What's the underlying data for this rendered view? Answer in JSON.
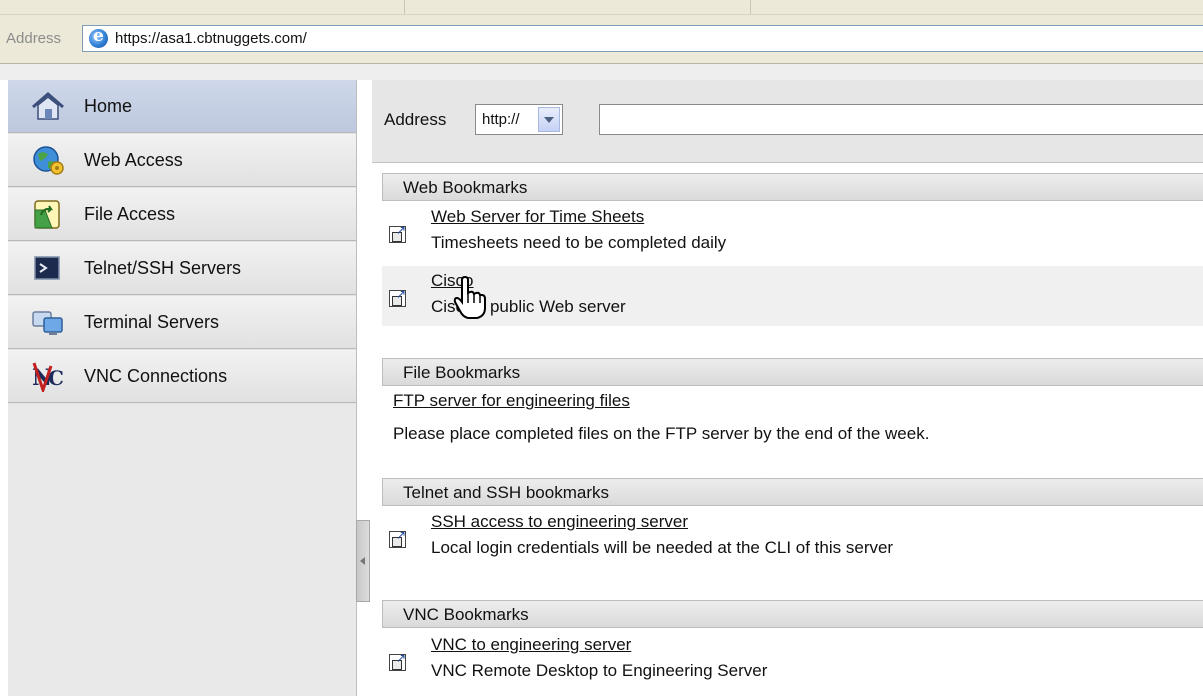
{
  "browser": {
    "address_label": "Address",
    "url": "https://asa1.cbtnuggets.com/"
  },
  "sidebar": {
    "items": [
      {
        "label": "Home",
        "icon": "home-icon"
      },
      {
        "label": "Web Access",
        "icon": "web-access-icon"
      },
      {
        "label": "File Access",
        "icon": "file-access-icon"
      },
      {
        "label": "Telnet/SSH Servers",
        "icon": "terminal-icon"
      },
      {
        "label": "Terminal Servers",
        "icon": "terminal-servers-icon"
      },
      {
        "label": "VNC Connections",
        "icon": "vnc-icon"
      }
    ],
    "active_item": "Home"
  },
  "main": {
    "address_label": "Address",
    "protocol_value": "http://",
    "url_value": "",
    "sections": {
      "web": {
        "title": "Web Bookmarks",
        "items": [
          {
            "link": "Web Server for Time Sheets",
            "desc": "Timesheets need to be completed daily"
          },
          {
            "link": "Cisco",
            "desc": "Cisco's public Web server"
          }
        ]
      },
      "file": {
        "title": "File Bookmarks",
        "items": [
          {
            "link": "FTP server for engineering files",
            "desc": "Please place completed files on the FTP server by the end of the week."
          }
        ]
      },
      "telnet": {
        "title": "Telnet and SSH bookmarks",
        "items": [
          {
            "link": "SSH access to engineering server",
            "desc": "Local login credentials will be needed at the CLI of this server"
          }
        ]
      },
      "vnc": {
        "title": "VNC Bookmarks",
        "items": [
          {
            "link": "VNC to engineering server",
            "desc": "VNC Remote Desktop to Engineering Server"
          }
        ]
      }
    }
  },
  "colors": {
    "chrome": "#ece9d8",
    "sidebar_active": "#c6d0e4",
    "section_header": "#e2e2e2",
    "hover_row": "#f0f0f0"
  }
}
